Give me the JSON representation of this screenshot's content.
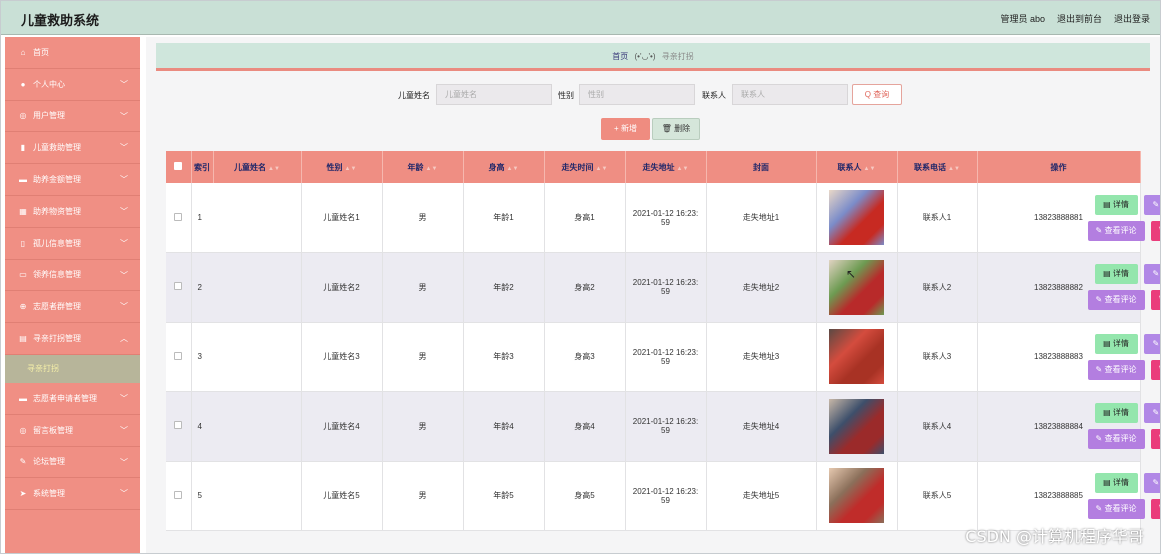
{
  "app": {
    "title": "儿童救助系统",
    "user_label": "管理员 abo",
    "to_front": "退出到前台",
    "logout": "退出登录"
  },
  "sidebar": {
    "items": [
      {
        "label": "首页",
        "icon": "home-icon",
        "glyph": "⌂",
        "expandable": false
      },
      {
        "label": "个人中心",
        "icon": "user-icon",
        "glyph": "●",
        "expandable": true
      },
      {
        "label": "用户管理",
        "icon": "users-icon",
        "glyph": "◎",
        "expandable": true
      },
      {
        "label": "儿童救助管理",
        "icon": "shield-icon",
        "glyph": "▮",
        "expandable": true
      },
      {
        "label": "助养金额管理",
        "icon": "money-icon",
        "glyph": "▬",
        "expandable": true
      },
      {
        "label": "助养物资管理",
        "icon": "grid-icon",
        "glyph": "▦",
        "expandable": true
      },
      {
        "label": "孤儿信息管理",
        "icon": "mic-icon",
        "glyph": "▯",
        "expandable": true
      },
      {
        "label": "领养信息管理",
        "icon": "chat-icon",
        "glyph": "▭",
        "expandable": true
      },
      {
        "label": "志愿者群管理",
        "icon": "globe-icon",
        "glyph": "⊕",
        "expandable": true
      },
      {
        "label": "寻亲打拐管理",
        "icon": "document-icon",
        "glyph": "▤",
        "expandable": true,
        "open": true
      }
    ],
    "sub_item": "寻亲打拐",
    "items_after": [
      {
        "label": "志愿者申请者管理",
        "icon": "briefcase-icon",
        "glyph": "▬",
        "expandable": true
      },
      {
        "label": "留言板管理",
        "icon": "message-icon",
        "glyph": "◎",
        "expandable": true
      },
      {
        "label": "论坛管理",
        "icon": "forum-icon",
        "glyph": "✎",
        "expandable": true
      },
      {
        "label": "系统管理",
        "icon": "send-icon",
        "glyph": "➤",
        "expandable": true
      }
    ]
  },
  "breadcrumb": {
    "home": "首页",
    "emote": "(•'◡'•)",
    "current": "寻亲打拐"
  },
  "search": {
    "name_label": "儿童姓名",
    "name_placeholder": "儿童姓名",
    "gender_label": "性别",
    "gender_placeholder": "性别",
    "contact_label": "联系人",
    "contact_placeholder": "联系人",
    "query_button": "Q 查询"
  },
  "actions": {
    "add": "+ 新增",
    "delete": "🗑 删除"
  },
  "table": {
    "headers": [
      "索引",
      "儿童姓名",
      "性别",
      "年龄",
      "身高",
      "走失时间",
      "走失地址",
      "封面",
      "联系人",
      "联系电话",
      "操作"
    ],
    "rows": [
      {
        "idx": "1",
        "name": "儿童姓名1",
        "gender": "男",
        "age": "年龄1",
        "height": "身高1",
        "time_a": "2021-01-12 16:23:",
        "time_b": "59",
        "addr": "走失地址1",
        "contact": "联系人1",
        "phone": "13823888881"
      },
      {
        "idx": "2",
        "name": "儿童姓名2",
        "gender": "男",
        "age": "年龄2",
        "height": "身高2",
        "time_a": "2021-01-12 16:23:",
        "time_b": "59",
        "addr": "走失地址2",
        "contact": "联系人2",
        "phone": "13823888882"
      },
      {
        "idx": "3",
        "name": "儿童姓名3",
        "gender": "男",
        "age": "年龄3",
        "height": "身高3",
        "time_a": "2021-01-12 16:23:",
        "time_b": "59",
        "addr": "走失地址3",
        "contact": "联系人3",
        "phone": "13823888883"
      },
      {
        "idx": "4",
        "name": "儿童姓名4",
        "gender": "男",
        "age": "年龄4",
        "height": "身高4",
        "time_a": "2021-01-12 16:23:",
        "time_b": "59",
        "addr": "走失地址4",
        "contact": "联系人4",
        "phone": "13823888884"
      },
      {
        "idx": "5",
        "name": "儿童姓名5",
        "gender": "男",
        "age": "年龄5",
        "height": "身高5",
        "time_a": "2021-01-12 16:23:",
        "time_b": "59",
        "addr": "走失地址5",
        "contact": "联系人5",
        "phone": "13823888885"
      }
    ],
    "op_labels": {
      "detail": "▤ 详情",
      "edit": "✎ 修改",
      "comment": "✎ 查看评论",
      "remove": "🗑 删除"
    }
  },
  "watermark": "CSDN @计算机程序华哥",
  "colors": {
    "topbar": "#c9e0d6",
    "sidebar": "#f08f84",
    "table_header": "#ef8e83",
    "detail_btn": "#94e6ad",
    "edit_btn": "#b188e6",
    "remove_btn": "#ea3d7b"
  }
}
